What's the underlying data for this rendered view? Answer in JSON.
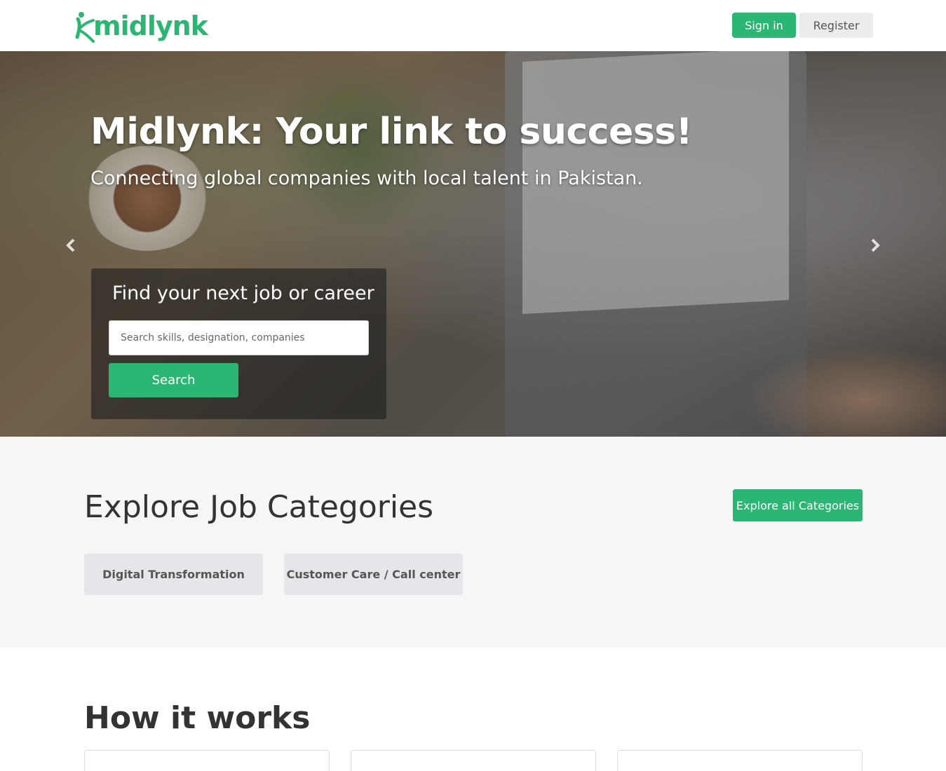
{
  "header": {
    "logo_text": "midlynk",
    "signin_label": "Sign in",
    "register_label": "Register"
  },
  "hero": {
    "title": "Midlynk: Your link to success!",
    "subtitle": "Connecting global companies with local talent in Pakistan.",
    "prev_icon": "‹",
    "next_icon": "›",
    "search": {
      "title": "Find your next job or career",
      "placeholder": "Search skills, designation, companies",
      "value": "",
      "button_label": "Search"
    }
  },
  "categories": {
    "title": "Explore Job Categories",
    "explore_all_label": "Explore all Categories",
    "items": [
      {
        "label": "Digital Transformation"
      },
      {
        "label": "Customer Care / Call center"
      }
    ]
  },
  "how_it_works": {
    "title": "How it works"
  },
  "colors": {
    "brand": "#2bb673",
    "section_bg": "#f5f6f8",
    "category_card": "#e4e6e9"
  },
  "icons": {
    "logo": "midlynk-logo-icon",
    "prev": "chevron-left-icon",
    "next": "chevron-right-icon"
  }
}
